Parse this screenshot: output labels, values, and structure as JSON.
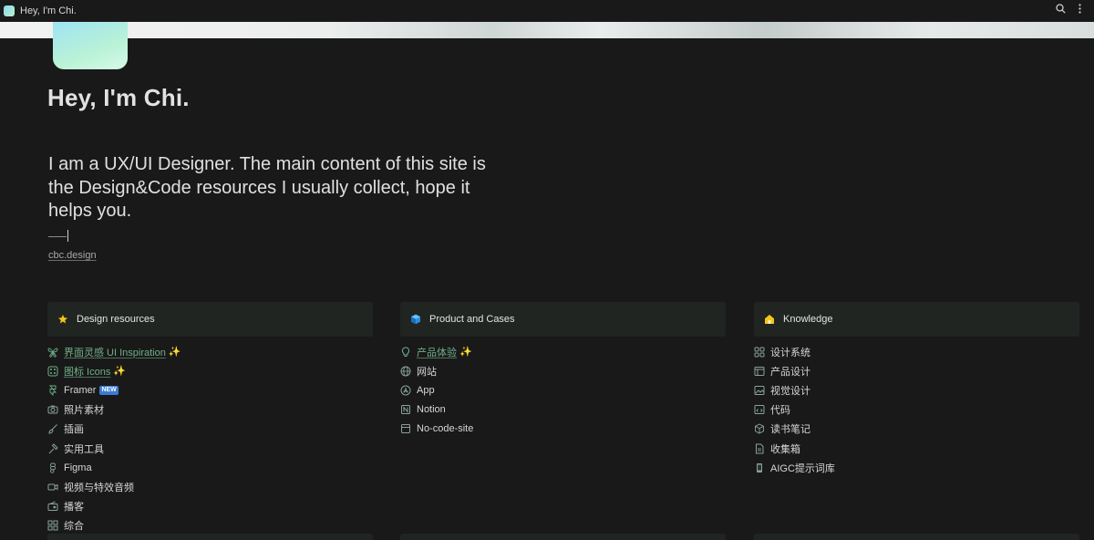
{
  "tab": {
    "title": "Hey, I'm Chi."
  },
  "page": {
    "title": "Hey, I'm Chi.",
    "intro": "I am a UX/UI Designer. The main content of this site is the Design&Code resources I usually collect, hope it helps you.",
    "link": "cbc.design"
  },
  "columns": [
    {
      "title": "Design resources",
      "icon": "star-icon",
      "items": [
        {
          "label": "界面灵感 UI Inspiration",
          "icon": "butterfly-icon",
          "link": true,
          "suffix": "✨"
        },
        {
          "label": "图标 Icons",
          "icon": "icon-grid-icon",
          "link": true,
          "suffix": "✨"
        },
        {
          "label": "Framer",
          "icon": "framer-icon",
          "link": false,
          "badge": "NEW"
        },
        {
          "label": "照片素材",
          "icon": "camera-icon",
          "link": false
        },
        {
          "label": "插画",
          "icon": "brush-icon",
          "link": false
        },
        {
          "label": "实用工具",
          "icon": "hammer-icon",
          "link": false
        },
        {
          "label": "Figma",
          "icon": "figma-icon",
          "link": false
        },
        {
          "label": "视频与特效音频",
          "icon": "video-icon",
          "link": false
        },
        {
          "label": "播客",
          "icon": "radio-icon",
          "link": false
        },
        {
          "label": "综合",
          "icon": "grid-icon",
          "link": false
        }
      ]
    },
    {
      "title": "Product and Cases",
      "icon": "cube-icon",
      "items": [
        {
          "label": "产品体验",
          "icon": "lightbulb-icon",
          "link": true,
          "suffix": "✨"
        },
        {
          "label": "网站",
          "icon": "globe-icon",
          "link": false
        },
        {
          "label": "App",
          "icon": "app-store-icon",
          "link": false
        },
        {
          "label": "Notion",
          "icon": "notion-icon",
          "link": false
        },
        {
          "label": "No-code-site",
          "icon": "database-icon",
          "link": false
        }
      ]
    },
    {
      "title": "Knowledge",
      "icon": "house-icon",
      "items": [
        {
          "label": "设计系统",
          "icon": "components-icon",
          "link": false
        },
        {
          "label": "产品设计",
          "icon": "window-icon",
          "link": false
        },
        {
          "label": "视觉设计",
          "icon": "picture-icon",
          "link": false
        },
        {
          "label": "代码",
          "icon": "code-window-icon",
          "link": false
        },
        {
          "label": "读书笔记",
          "icon": "box-icon",
          "link": false
        },
        {
          "label": "收集箱",
          "icon": "document-icon",
          "link": false
        },
        {
          "label": "AIGC提示词库",
          "icon": "phone-icon",
          "link": false
        }
      ]
    }
  ]
}
